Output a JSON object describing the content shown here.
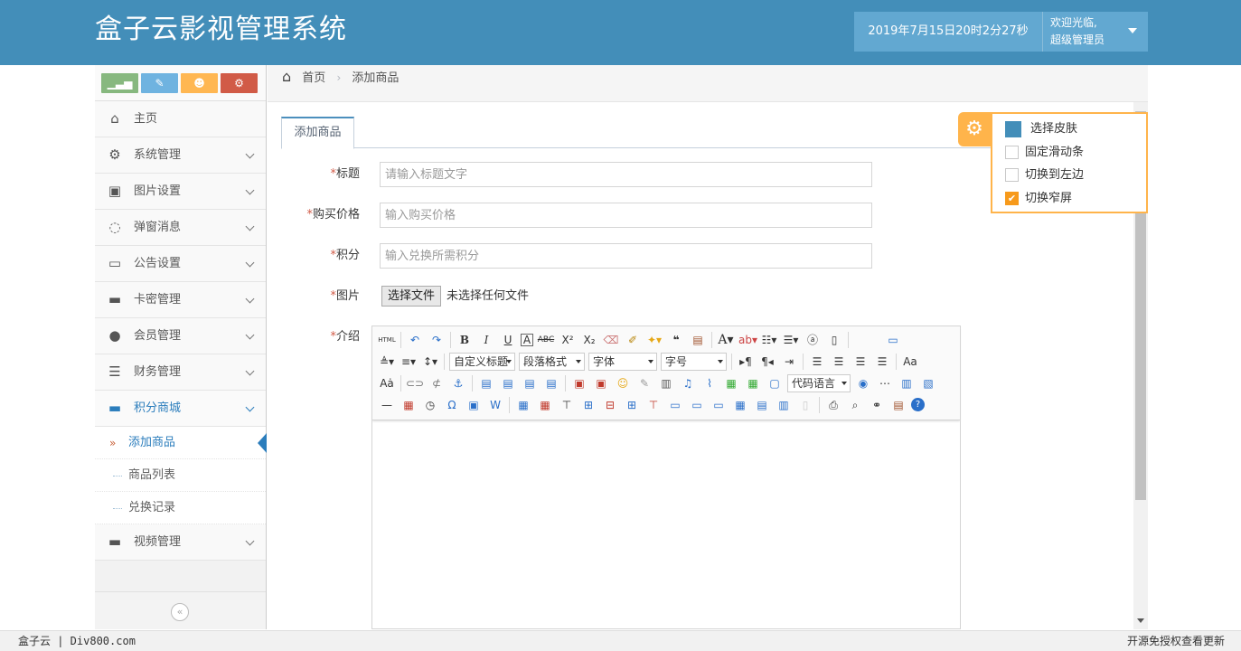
{
  "header": {
    "title": "盒子云影视管理系统",
    "datetime": "2019年7月15日20时2分27秒",
    "welcome": "欢迎光临,",
    "user": "超级管理员",
    "bg_color": "#438eb9"
  },
  "sidebar": {
    "shortcuts": [
      {
        "icon": "signal-icon",
        "glyph": "▁▃▅",
        "color": "#87b87f"
      },
      {
        "icon": "pencil-icon",
        "glyph": "✎",
        "color": "#6fb3e0"
      },
      {
        "icon": "users-icon",
        "glyph": "👥",
        "color": "#ffb752"
      },
      {
        "icon": "cogs-icon",
        "glyph": "⚙",
        "color": "#d15b47"
      }
    ],
    "items": [
      {
        "label": "主页",
        "icon": "home-icon"
      },
      {
        "label": "系统管理",
        "icon": "cogs-icon"
      },
      {
        "label": "图片设置",
        "icon": "picture-icon"
      },
      {
        "label": "弹窗消息",
        "icon": "comments-icon"
      },
      {
        "label": "公告设置",
        "icon": "laptop-icon"
      },
      {
        "label": "卡密管理",
        "icon": "desktop-icon"
      },
      {
        "label": "会员管理",
        "icon": "user-icon"
      },
      {
        "label": "财务管理",
        "icon": "list-icon"
      },
      {
        "label": "积分商城",
        "icon": "desktop-icon"
      },
      {
        "label": "视频管理",
        "icon": "desktop-icon"
      }
    ],
    "sub_items": [
      {
        "label": "添加商品"
      },
      {
        "label": "商品列表"
      },
      {
        "label": "兑换记录"
      }
    ]
  },
  "breadcrumb": {
    "home": "首页",
    "current": "添加商品"
  },
  "tab": {
    "label": "添加商品"
  },
  "form": {
    "title_label": "标题",
    "title_placeholder": "请输入标题文字",
    "price_label": "购买价格",
    "price_placeholder": "输入购买价格",
    "points_label": "积分",
    "points_placeholder": "输入兑换所需积分",
    "image_label": "图片",
    "file_button": "选择文件",
    "file_status": "未选择任何文件",
    "intro_label": "介绍",
    "required_mark": "*"
  },
  "editor": {
    "custom_title": "自定义标题",
    "paragraph": "段落格式",
    "font": "字体",
    "font_size": "字号",
    "code_lang": "代码语言"
  },
  "skin_panel": {
    "choose_skin": "选择皮肤",
    "fixed_scroll": "固定滑动条",
    "switch_left": "切换到左边",
    "narrow_screen": "切换窄屏",
    "narrow_checked": true,
    "accent": "#ffb44b"
  },
  "footer": {
    "left": "盒子云 | Div800.com",
    "right": "开源免授权查看更新"
  }
}
